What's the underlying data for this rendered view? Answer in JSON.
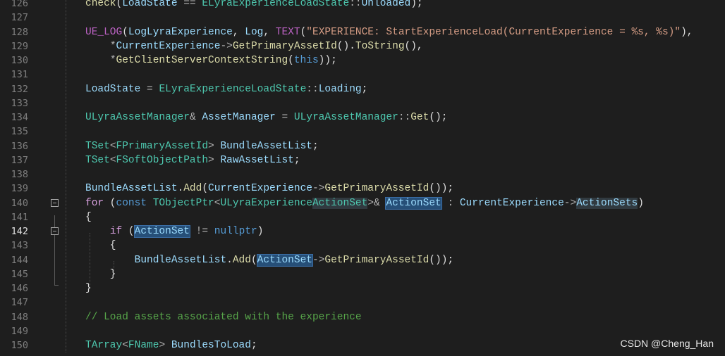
{
  "editor": {
    "lines": [
      {
        "num": "126",
        "text": "check(LoadState == ELyraExperienceLoadState::Unloaded);"
      },
      {
        "num": "127",
        "text": ""
      },
      {
        "num": "128",
        "text": "UE_LOG(LogLyraExperience, Log, TEXT(\"EXPERIENCE: StartExperienceLoad(CurrentExperience = %s, %s)\"),"
      },
      {
        "num": "129",
        "text": "    *CurrentExperience->GetPrimaryAssetId().ToString(),"
      },
      {
        "num": "130",
        "text": "    *GetClientServerContextString(this));"
      },
      {
        "num": "131",
        "text": ""
      },
      {
        "num": "132",
        "text": "LoadState = ELyraExperienceLoadState::Loading;"
      },
      {
        "num": "133",
        "text": ""
      },
      {
        "num": "134",
        "text": "ULyraAssetManager& AssetManager = ULyraAssetManager::Get();"
      },
      {
        "num": "135",
        "text": ""
      },
      {
        "num": "136",
        "text": "TSet<FPrimaryAssetId> BundleAssetList;"
      },
      {
        "num": "137",
        "text": "TSet<FSoftObjectPath> RawAssetList;"
      },
      {
        "num": "138",
        "text": ""
      },
      {
        "num": "139",
        "text": "BundleAssetList.Add(CurrentExperience->GetPrimaryAssetId());"
      },
      {
        "num": "140",
        "text": "for (const TObjectPtr<ULyraExperienceActionSet>& ActionSet : CurrentExperience->ActionSets)"
      },
      {
        "num": "141",
        "text": "{"
      },
      {
        "num": "142",
        "text": "    if (ActionSet != nullptr)"
      },
      {
        "num": "143",
        "text": "    {"
      },
      {
        "num": "144",
        "text": "        BundleAssetList.Add(ActionSet->GetPrimaryAssetId());"
      },
      {
        "num": "145",
        "text": "    }"
      },
      {
        "num": "146",
        "text": "}"
      },
      {
        "num": "147",
        "text": ""
      },
      {
        "num": "148",
        "text": "// Load assets associated with the experience"
      },
      {
        "num": "149",
        "text": ""
      },
      {
        "num": "150",
        "text": "TArray<FName> BundlesToLoad;"
      }
    ],
    "active_line": "142",
    "colors": {
      "background": "#1e1e1e",
      "keyword": "#569cd6",
      "function": "#dcdcaa",
      "type": "#4ec9b0",
      "variable": "#9cdcfe",
      "string": "#d69d85",
      "macro": "#bd63c5",
      "comment": "#57a64a",
      "highlight": "#264f78"
    }
  },
  "watermark": "CSDN @Cheng_Han"
}
